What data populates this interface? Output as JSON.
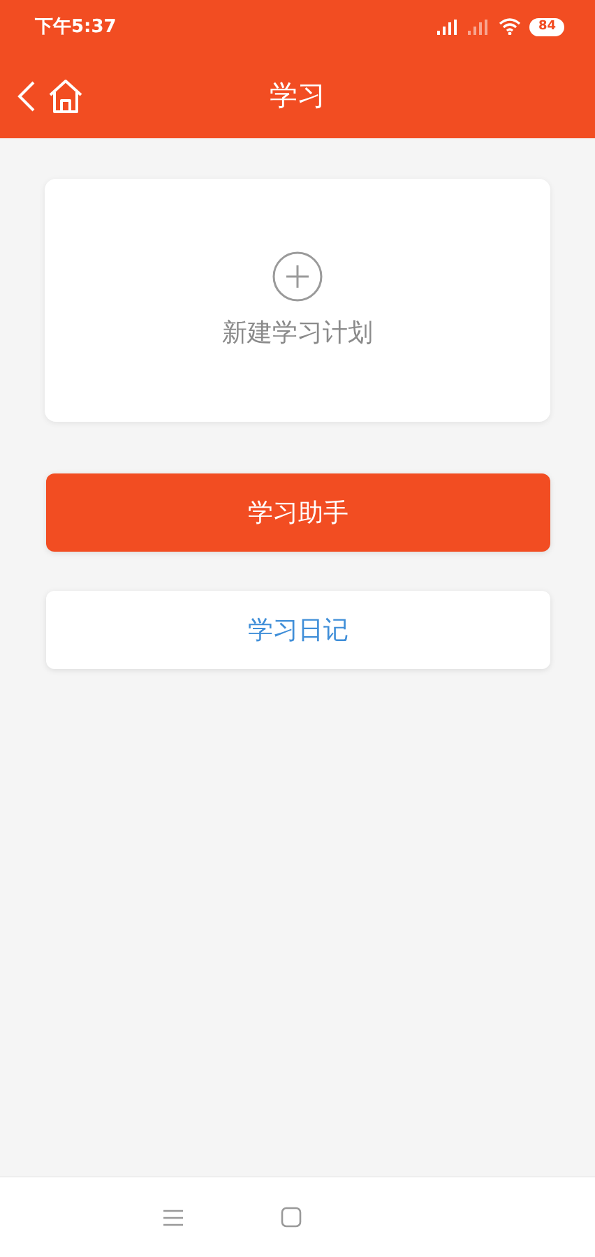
{
  "status_bar": {
    "time": "下午5:37",
    "battery": "84"
  },
  "header": {
    "title": "学习"
  },
  "new_plan_card": {
    "label": "新建学习计划"
  },
  "buttons": [
    {
      "label": "学习助手",
      "kind": "primary"
    },
    {
      "label": "学习日记",
      "kind": "secondary"
    }
  ]
}
